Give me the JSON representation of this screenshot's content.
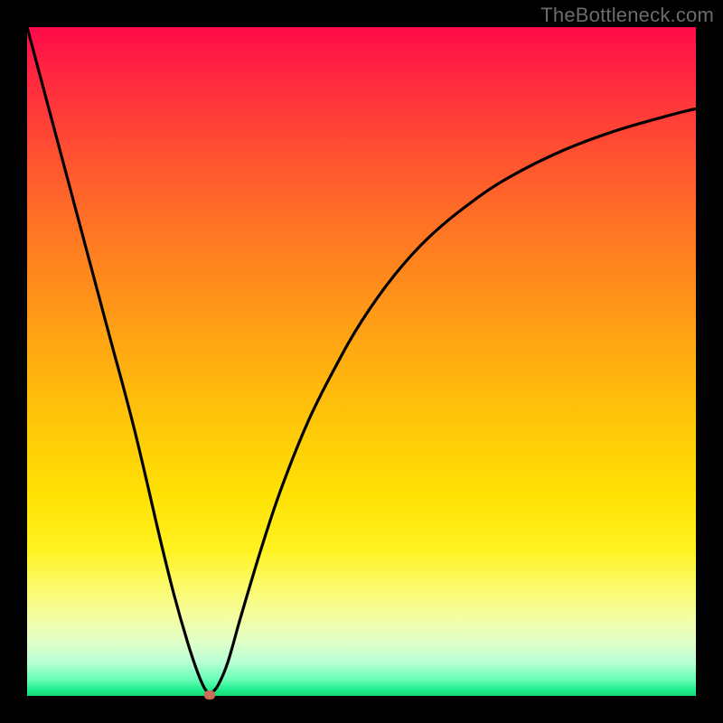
{
  "watermark": "TheBottleneck.com",
  "chart_data": {
    "type": "line",
    "title": "",
    "xlabel": "",
    "ylabel": "",
    "xlim": [
      0,
      100
    ],
    "ylim": [
      0,
      100
    ],
    "grid": false,
    "legend": false,
    "series": [
      {
        "name": "left-branch",
        "x": [
          0,
          4,
          8,
          12,
          16,
          20,
          22,
          24,
          25.5,
          26.5,
          27.3
        ],
        "y": [
          100,
          85,
          70,
          55,
          40,
          23,
          15,
          8,
          3.5,
          1.2,
          0.2
        ]
      },
      {
        "name": "right-branch",
        "x": [
          27.3,
          28.5,
          30,
          32,
          35,
          38,
          42,
          46,
          50,
          55,
          60,
          66,
          72,
          80,
          88,
          96,
          100
        ],
        "y": [
          0.2,
          1.5,
          5,
          12,
          22,
          31,
          41,
          49,
          56,
          63,
          68.5,
          73.5,
          77.5,
          81.5,
          84.5,
          86.8,
          87.8
        ]
      }
    ],
    "marker": {
      "x": 27.3,
      "y": 0.2,
      "color": "#cc6b5a"
    },
    "background_gradient": {
      "stops": [
        {
          "pos": 0,
          "color": "#ff0a4a"
        },
        {
          "pos": 0.5,
          "color": "#ffc409"
        },
        {
          "pos": 0.85,
          "color": "#fcfb6e"
        },
        {
          "pos": 1.0,
          "color": "#14d873"
        }
      ]
    }
  },
  "colors": {
    "curve": "#000000",
    "frame": "#000000",
    "marker": "#cc6b5a"
  }
}
